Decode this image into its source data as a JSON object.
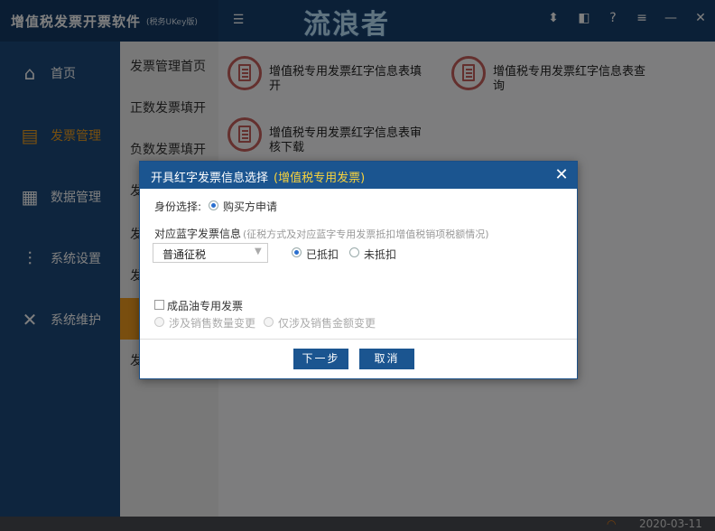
{
  "app": {
    "title": "增值税发票开票软件",
    "subtitle": "(税务UKey版)",
    "watermark": "流浪者"
  },
  "toolbar": {
    "icons": [
      "download-icon",
      "bookmark-icon",
      "help-icon",
      "menu-icon",
      "minimize-icon",
      "close-icon"
    ]
  },
  "sidebar": {
    "items": [
      {
        "label": "首页",
        "icon": "home-icon"
      },
      {
        "label": "发票管理",
        "icon": "printer-icon",
        "active": true
      },
      {
        "label": "数据管理",
        "icon": "data-icon"
      },
      {
        "label": "系统设置",
        "icon": "sliders-icon"
      },
      {
        "label": "系统维护",
        "icon": "tools-icon"
      }
    ]
  },
  "submenu": {
    "items": [
      {
        "label": "发票管理首页"
      },
      {
        "label": "正数发票填开"
      },
      {
        "label": "负数发票填开"
      },
      {
        "label": "发"
      },
      {
        "label": "发"
      },
      {
        "label": "发"
      },
      {
        "label": ""
      },
      {
        "label": "发"
      }
    ]
  },
  "main": {
    "functions": [
      {
        "label": "增值税专用发票红字信息表填开"
      },
      {
        "label": "增值税专用发票红字信息表查询"
      },
      {
        "label": "增值税专用发票红字信息表审核下载"
      }
    ]
  },
  "dialog": {
    "title": "开具红字发票信息选择",
    "title_highlight": "(增值税专用发票)",
    "identity_label": "身份选择:",
    "identity_option": "购买方申请",
    "blue_info_label": "对应蓝字发票信息",
    "blue_info_hint": "(征税方式及对应蓝字专用发票抵扣增值税销项税额情况)",
    "tax_select_value": "普通征税",
    "deducted_label": "已抵扣",
    "not_deducted_label": "未抵扣",
    "oil_label": "成品油专用发票",
    "qty_change_label": "涉及销售数量变更",
    "amount_change_label": "仅涉及销售金额变更",
    "next_button": "下一步",
    "cancel_button": "取消"
  },
  "statusbar": {
    "date": "2020-03-11"
  }
}
